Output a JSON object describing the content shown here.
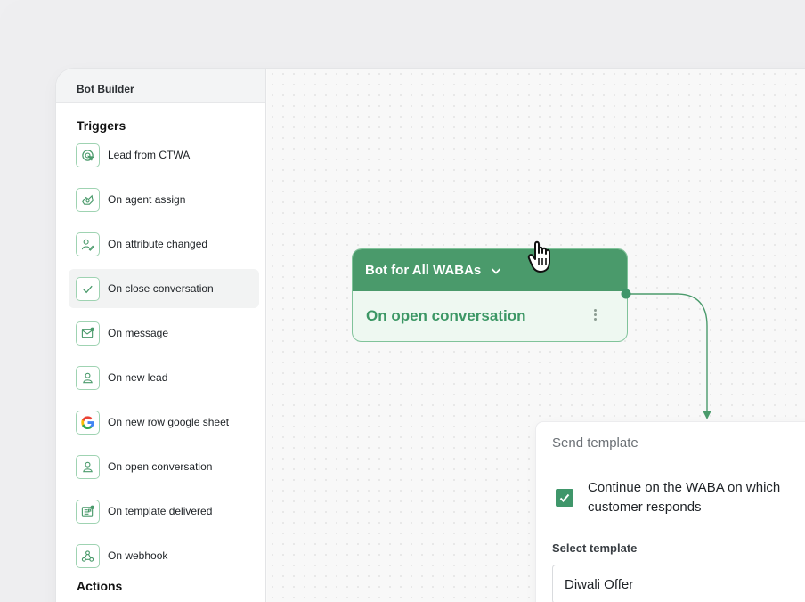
{
  "sidebar": {
    "title": "Bot Builder",
    "triggers_heading": "Triggers",
    "actions_heading": "Actions",
    "items": [
      {
        "label": "Lead from CTWA",
        "icon": "target-cursor-icon"
      },
      {
        "label": "On agent assign",
        "icon": "agent-assign-icon"
      },
      {
        "label": "On attribute changed",
        "icon": "user-edit-icon"
      },
      {
        "label": "On close conversation",
        "icon": "check-icon"
      },
      {
        "label": "On message",
        "icon": "mail-icon"
      },
      {
        "label": "On new lead",
        "icon": "user-icon"
      },
      {
        "label": "On new row google sheet",
        "icon": "google-icon"
      },
      {
        "label": "On open conversation",
        "icon": "user-icon"
      },
      {
        "label": "On template delivered",
        "icon": "template-icon"
      },
      {
        "label": "On webhook",
        "icon": "webhook-icon"
      }
    ]
  },
  "node": {
    "title": "Bot for All WABAs",
    "trigger": "On open conversation"
  },
  "panel": {
    "title": "Send template",
    "checkbox_label": "Continue on the WABA on which customer responds",
    "checkbox_checked": true,
    "select_label": "Select template",
    "select_value": "Diwali Offer"
  },
  "colors": {
    "accent": "#4a9a6b",
    "accent_text": "#3c9765",
    "icon_border": "#9fd3b2"
  }
}
